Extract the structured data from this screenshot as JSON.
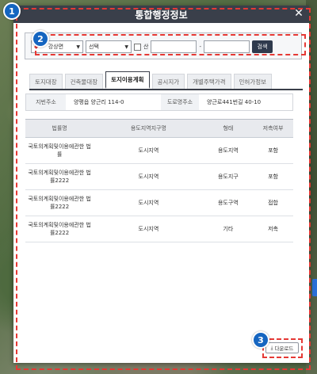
{
  "dialog": {
    "title": "통합행정정보",
    "close_label": "✕"
  },
  "search": {
    "district_value": "강상면",
    "district_icon": "pin-icon",
    "dong_value": "선택",
    "mountain_label": "산",
    "separator": "-",
    "search_button": "검색"
  },
  "tabs": [
    {
      "label": "토지대장"
    },
    {
      "label": "건축물대장"
    },
    {
      "label": "토지이용계획"
    },
    {
      "label": "공시지가"
    },
    {
      "label": "개별주택가격"
    },
    {
      "label": "인허가정보"
    }
  ],
  "active_tab_index": 2,
  "address": {
    "jibun_label": "지번주소",
    "jibun_value": "양평읍 양근리 114-0",
    "road_label": "도로명주소",
    "road_value": "양근로441번길 40-10"
  },
  "table": {
    "headers": [
      "법률명",
      "용도지역지구명",
      "형태",
      "저촉여부"
    ],
    "rows": [
      {
        "law": "국토의계획및이용에관한 법률",
        "zone": "도시지역",
        "type": "용도지역",
        "status": "포함"
      },
      {
        "law": "국토의계획및이용에관한 법률2222",
        "zone": "도시지역",
        "type": "용도지구",
        "status": "포함"
      },
      {
        "law": "국토의계획및이용에관한 법률2222",
        "zone": "도시지역",
        "type": "용도구역",
        "status": "접합"
      },
      {
        "law": "국토의계획및이용에관한 법률2222",
        "zone": "도시지역",
        "type": "기타",
        "status": "저촉"
      }
    ]
  },
  "download": {
    "label": "다운로드",
    "icon": "download-icon"
  },
  "annotations": [
    "1",
    "2",
    "3"
  ],
  "colors": {
    "titlebar": "#3a3f4a",
    "annotation_border": "#e53935",
    "badge": "#1565c0"
  }
}
